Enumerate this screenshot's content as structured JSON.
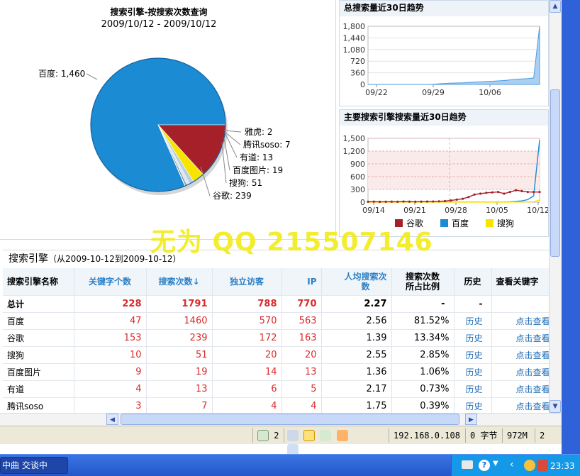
{
  "pie": {
    "title": "搜索引擎-按搜索次数查询",
    "subtitle": "2009/10/12 - 2009/10/12",
    "labels": [
      "百度: 1,460",
      "雅虎: 2",
      "腾讯soso: 7",
      "有道: 13",
      "百度图片: 19",
      "搜狗: 51",
      "谷歌: 239"
    ]
  },
  "trend_total": {
    "title": "总搜索量近30日趋势",
    "yticks": [
      "1,800",
      "1,440",
      "1,080",
      "720",
      "360",
      "0"
    ],
    "xticks": [
      "09/22",
      "09/29",
      "10/06"
    ]
  },
  "trend_main": {
    "title": "主要搜索引擎搜索量近30日趋势",
    "yticks": [
      "1,500",
      "1,200",
      "900",
      "600",
      "300",
      "0"
    ],
    "xticks": [
      "09/14",
      "09/21",
      "09/28",
      "10/05",
      "10/12"
    ],
    "legend": [
      "谷歌",
      "百度",
      "搜狗"
    ]
  },
  "chart_data": [
    {
      "type": "pie",
      "title": "搜索引擎-按搜索次数查询",
      "subtitle": "2009/10/12 - 2009/10/12",
      "categories": [
        "百度",
        "谷歌",
        "搜狗",
        "百度图片",
        "有道",
        "腾讯soso",
        "雅虎"
      ],
      "values": [
        1460,
        239,
        51,
        19,
        13,
        7,
        2
      ]
    },
    {
      "type": "area",
      "title": "总搜索量近30日趋势",
      "x": [
        "09/22",
        "09/29",
        "10/06"
      ],
      "ylim": [
        0,
        1800
      ]
    },
    {
      "type": "line",
      "title": "主要搜索引擎搜索量近30日趋势",
      "x": [
        "09/14",
        "09/21",
        "09/28",
        "10/05",
        "10/12"
      ],
      "ylim": [
        0,
        1500
      ],
      "series": [
        {
          "name": "谷歌"
        },
        {
          "name": "百度"
        },
        {
          "name": "搜狗"
        }
      ]
    }
  ],
  "watermark": "无为 QQ 215507146",
  "table": {
    "title": "搜索引擎",
    "subtitle": "（从2009-10-12到2009-10-12）",
    "headers": [
      "搜索引擎名称",
      "关键字个数",
      "搜索次数↓",
      "独立访客",
      "IP",
      "人均搜索次数",
      "搜索次数所占比例",
      "历史",
      "查看关键字"
    ],
    "total": [
      "总计",
      "228",
      "1791",
      "788",
      "770",
      "2.27",
      "-",
      "-",
      ""
    ],
    "rows": [
      [
        "百度",
        "47",
        "1460",
        "570",
        "563",
        "2.56",
        "81.52%",
        "历史",
        "点击查看"
      ],
      [
        "谷歌",
        "153",
        "239",
        "172",
        "163",
        "1.39",
        "13.34%",
        "历史",
        "点击查看"
      ],
      [
        "搜狗",
        "10",
        "51",
        "20",
        "20",
        "2.55",
        "2.85%",
        "历史",
        "点击查看"
      ],
      [
        "百度图片",
        "9",
        "19",
        "14",
        "13",
        "1.36",
        "1.06%",
        "历史",
        "点击查看"
      ],
      [
        "有道",
        "4",
        "13",
        "6",
        "5",
        "2.17",
        "0.73%",
        "历史",
        "点击查看"
      ],
      [
        "腾讯soso",
        "3",
        "7",
        "4",
        "4",
        "1.75",
        "0.39%",
        "历史",
        "点击查看"
      ]
    ]
  },
  "status": {
    "count": "2",
    "ip": "192.168.0.108",
    "bytes": "0 字节",
    "mem": "972M",
    "num": "2"
  },
  "taskbar": {
    "task": "中曲 交谈中",
    "clock": "23:33"
  },
  "colors": {
    "baidu": "#1b8bd3",
    "google": "#a6202a",
    "sogou": "#f7e400"
  }
}
